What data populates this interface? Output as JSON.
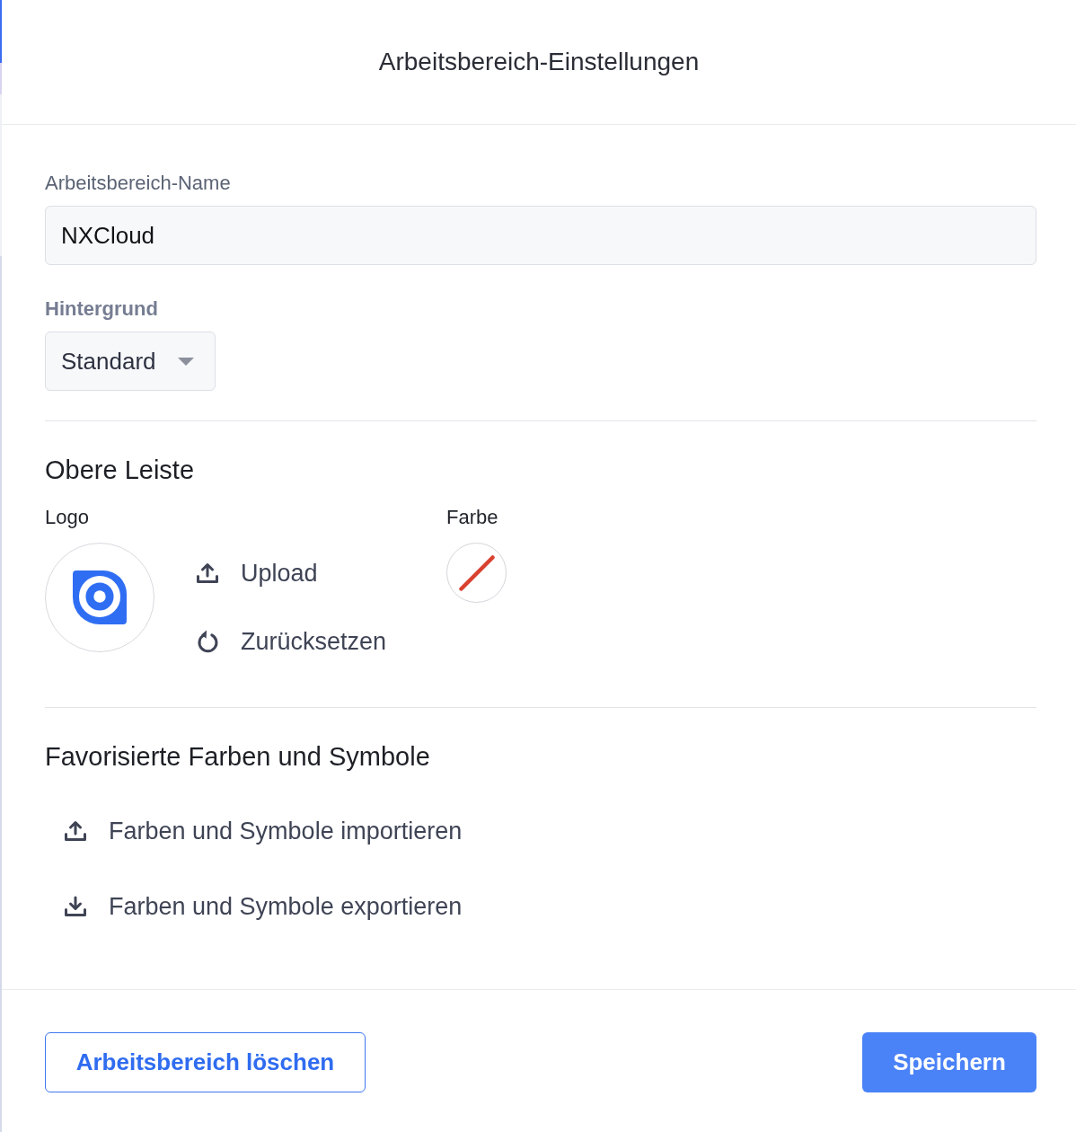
{
  "dialog": {
    "title": "Arbeitsbereich-Einstellungen"
  },
  "name_field": {
    "label": "Arbeitsbereich-Name",
    "value": "NXCloud"
  },
  "background_field": {
    "label": "Hintergrund",
    "value": "Standard"
  },
  "top_bar": {
    "heading": "Obere Leiste",
    "logo_label": "Logo",
    "logo_actions": [
      {
        "kind": "upload",
        "label": "Upload"
      },
      {
        "kind": "reset",
        "label": "Zurücksetzen"
      }
    ],
    "color_label": "Farbe"
  },
  "favorites": {
    "heading": "Favorisierte Farben und Symbole",
    "actions": [
      {
        "kind": "import",
        "label": "Farben und Symbole importieren"
      },
      {
        "kind": "export",
        "label": "Farben und Symbole exportieren"
      }
    ]
  },
  "buttons": [
    {
      "kind": "outline",
      "label": "Arbeitsbereich löschen"
    },
    {
      "kind": "filled",
      "label": "Speichern"
    }
  ]
}
